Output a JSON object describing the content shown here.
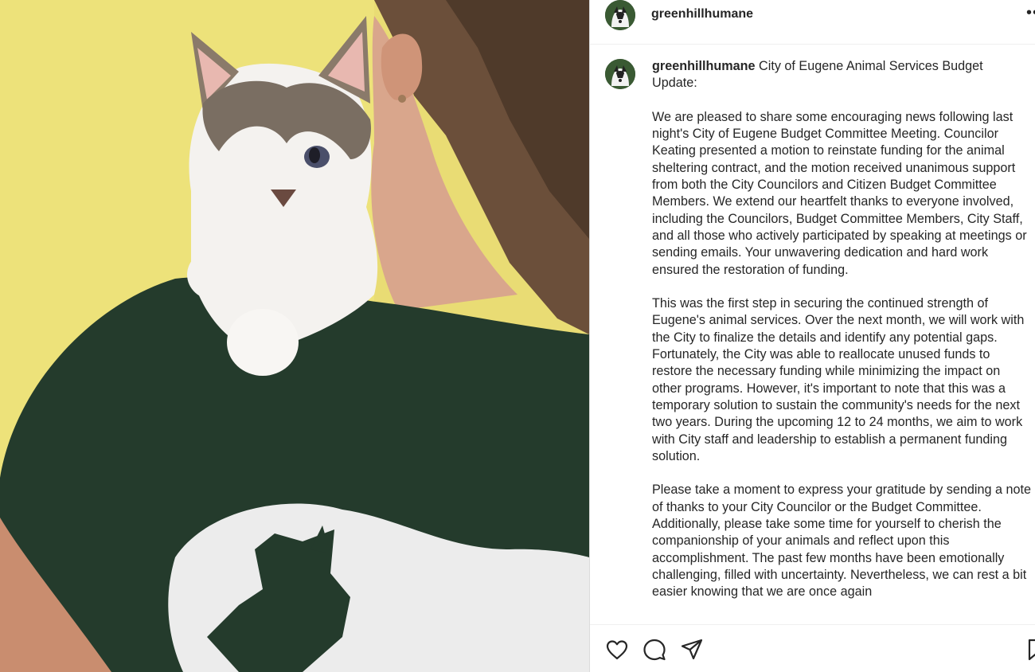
{
  "post": {
    "username": "greenhillhumane",
    "caption_user": "greenhillhumane",
    "caption_title": "City of Eugene Animal Services Budget Update:",
    "paragraphs": [
      "We are pleased to share some encouraging news following last night's City of Eugene Budget Committee Meeting. Councilor Keating presented a motion to reinstate funding for the animal sheltering contract, and the motion received unanimous support from both the City Councilors and Citizen Budget Committee Members. We extend our heartfelt thanks to everyone involved, including the Councilors, Budget Committee Members, City Staff, and all those who actively participated by speaking at meetings or sending emails. Your unwavering dedication and hard work ensured the restoration of funding.",
      "This was the first step in securing the continued strength of Eugene's animal services. Over the next month, we will work with the City to finalize the details and identify any potential gaps. Fortunately, the City was able to reallocate unused funds to restore the necessary funding while minimizing the impact on other programs. However, it's important to note that this was a temporary solution to sustain the community's needs for the next two years. During the upcoming 12 to 24 months, we aim to work with City staff and leadership to establish a permanent funding solution.",
      "Please take a moment to express your gratitude by sending a note of thanks to your City Councilor or the Budget Committee. Additionally, please take some time for yourself to cherish the companionship of your animals and reflect upon this accomplishment. The past few months have been emotionally challenging, filled with uncertainty. Nevertheless, we can rest a bit easier knowing that we are once again"
    ]
  },
  "icons": {
    "more": "more-options-icon",
    "like": "heart-icon",
    "comment": "comment-icon",
    "share": "share-icon",
    "save": "bookmark-icon"
  },
  "colors": {
    "text": "#262626",
    "divider": "#efefef",
    "wall": "#ece06f",
    "shirt": "#243b2c"
  }
}
